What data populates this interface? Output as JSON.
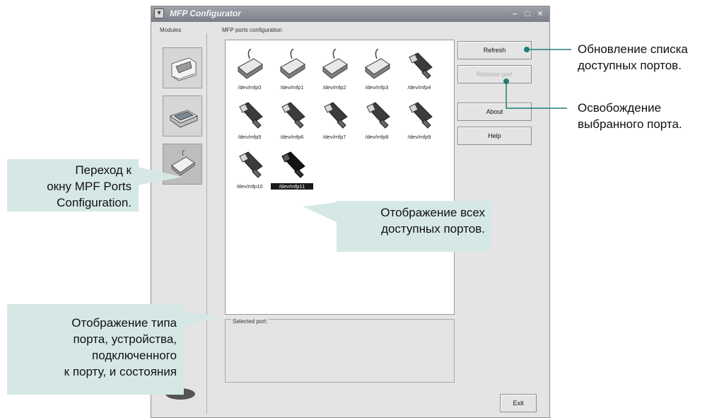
{
  "window": {
    "title": "MFP Configurator",
    "minimize_glyph": "–",
    "maximize_glyph": "□",
    "close_glyph": "×",
    "menu_glyph": "▾"
  },
  "modules_label": "Modules",
  "ports_group_label": "MFP ports configuration",
  "ports": [
    {
      "name": "/dev/mfp0",
      "icon": "parallel-port-icon"
    },
    {
      "name": "/dev/mfp1",
      "icon": "parallel-port-icon"
    },
    {
      "name": "/dev/mfp2",
      "icon": "parallel-port-icon"
    },
    {
      "name": "/dev/mfp3",
      "icon": "parallel-port-icon"
    },
    {
      "name": "/dev/mfp4",
      "icon": "usb-port-icon"
    },
    {
      "name": "/dev/mfp5",
      "icon": "usb-port-icon"
    },
    {
      "name": "/dev/mfp6",
      "icon": "usb-port-icon"
    },
    {
      "name": "/dev/mfp7",
      "icon": "usb-port-icon"
    },
    {
      "name": "/dev/mfp8",
      "icon": "usb-port-icon"
    },
    {
      "name": "/dev/mfp9",
      "icon": "usb-port-icon"
    },
    {
      "name": "/dev/mfp10",
      "icon": "usb-port-icon"
    },
    {
      "name": "/dev/mfp11",
      "icon": "usb-port-icon",
      "selected": true
    }
  ],
  "selected_port_label": "Selected port:",
  "buttons": {
    "refresh": "Refresh",
    "release": "Release port",
    "about": "About",
    "help": "Help",
    "exit": "Exit"
  },
  "callouts": {
    "refresh_line1": "Обновление списка",
    "refresh_line2": "доступных портов.",
    "release_line1": "Освобождение",
    "release_line2": "выбранного порта.",
    "ports_window_line1": "Переход к",
    "ports_window_line2": "окну MPF Ports",
    "ports_window_line3": "Configuration.",
    "all_ports_line1": "Отображение всех",
    "all_ports_line2": "доступных портов.",
    "port_type_line1": "Отображение типа",
    "port_type_line2": "порта, устройства,",
    "port_type_line3": "подключенного",
    "port_type_line4": "к порту, и состояния"
  },
  "colors": {
    "callout_bg": "#d5e8e5",
    "callout_line": "#1f7f73",
    "selected_bg": "#1a1a1a"
  }
}
